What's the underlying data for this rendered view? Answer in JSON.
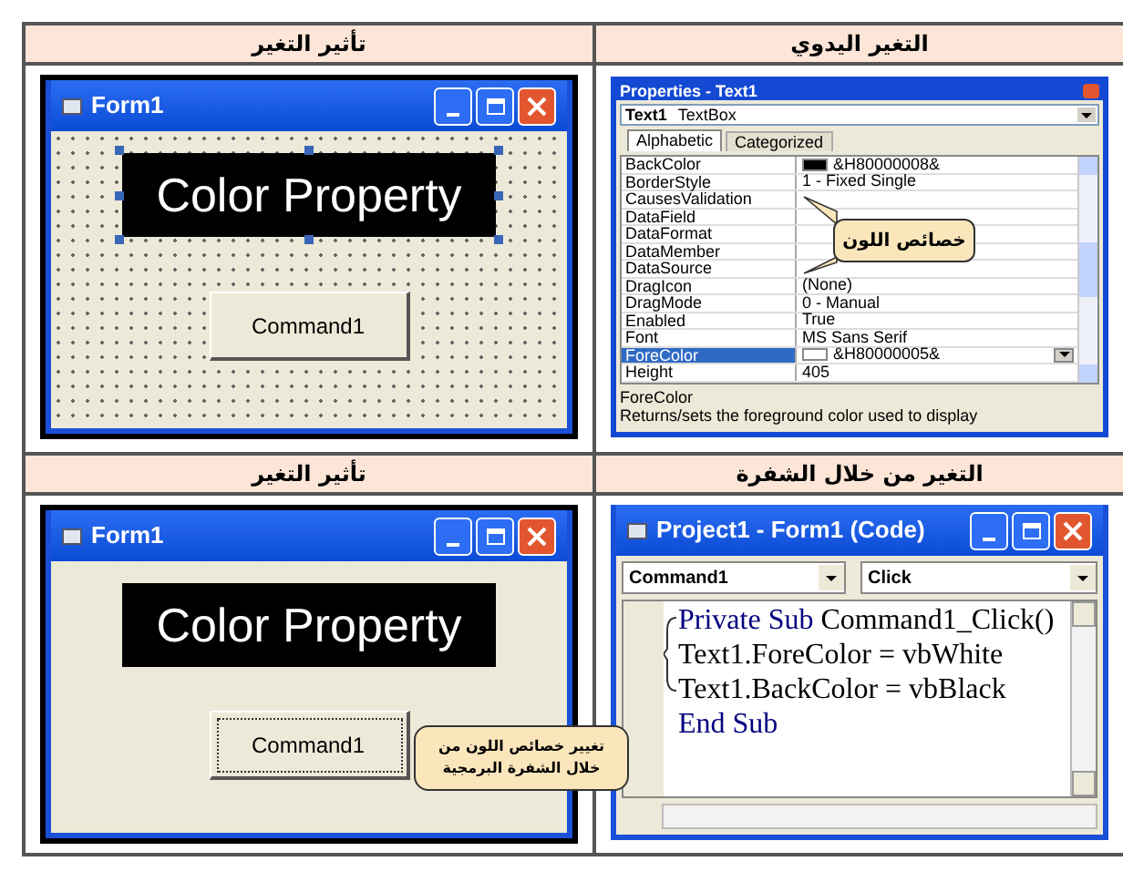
{
  "rows": [
    {
      "headers": [
        "التغير اليدوي",
        "تأثير التغير"
      ],
      "panels": [
        {
          "kind": "form",
          "title": "Form1",
          "design_grid": true,
          "label": "Color Property",
          "button": "Command1",
          "button_focused": false
        },
        {
          "kind": "properties",
          "title": "Properties - Text1",
          "object": "Text1",
          "object_type": "TextBox",
          "tabs": [
            {
              "label": "Alphabetic",
              "selected": true
            },
            {
              "label": "Categorized",
              "selected": false
            }
          ],
          "rows": [
            {
              "name": "BackColor",
              "value": "&H80000008&",
              "color": "#000000",
              "selected": false
            },
            {
              "name": "BorderStyle",
              "value": "1 - Fixed Single",
              "selected": false
            },
            {
              "name": "CausesValidation",
              "selected": false
            },
            {
              "name": "DataField",
              "selected": false
            },
            {
              "name": "DataFormat",
              "selected": false
            },
            {
              "name": "DataMember",
              "selected": false
            },
            {
              "name": "DataSource",
              "selected": false
            },
            {
              "name": "DragIcon",
              "value": "(None)",
              "selected": false
            },
            {
              "name": "DragMode",
              "value": "0 - Manual",
              "selected": false
            },
            {
              "name": "Enabled",
              "value": "True",
              "selected": false
            },
            {
              "name": "Font",
              "value": "MS Sans Serif",
              "selected": false
            },
            {
              "name": "ForeColor",
              "value": "&H80000005&",
              "color": "#ffffff",
              "selected": true
            },
            {
              "name": "Height",
              "value": "405",
              "selected": false
            }
          ],
          "description_title": "ForeColor",
          "description": "Returns/sets the foreground color used to display",
          "callout": "خصائص اللون"
        }
      ]
    },
    {
      "headers": [
        "التغير من خلال الشفرة",
        "تأثير التغير"
      ],
      "panels": [
        {
          "kind": "form",
          "title": "Form1",
          "design_grid": false,
          "label": "Color Property",
          "button": "Command1",
          "button_focused": true
        },
        {
          "kind": "code",
          "title": "Project1 - Form1 (Code)",
          "object": "Command1",
          "event": "Click",
          "lines": [
            {
              "keyword": "Private Sub",
              "text": "Command1_Click()"
            },
            {
              "text": "Text1.ForeColor = vbWhite"
            },
            {
              "text": "Text1.BackColor = vbBlack"
            },
            {
              "keyword": "End Sub"
            }
          ],
          "callout": "تغيير خصائص اللون من خلال الشفرة البرمجية"
        }
      ]
    }
  ]
}
